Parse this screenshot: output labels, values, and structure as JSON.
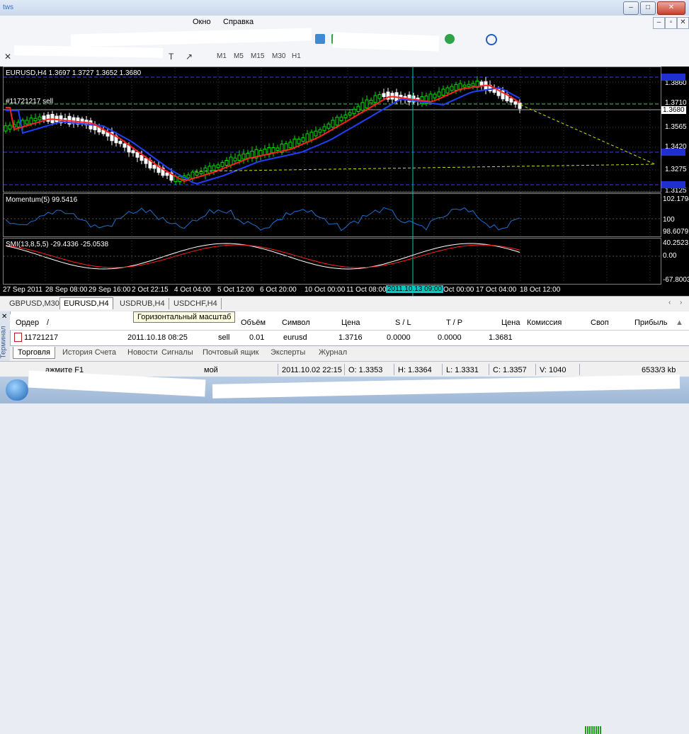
{
  "title_bar": {
    "left_text": "tws"
  },
  "window_controls": {
    "minimize": "–",
    "maximize": "□",
    "close": "✕"
  },
  "mdi_controls": {
    "minimize": "–",
    "restore": "▫",
    "close": "✕"
  },
  "menu": {
    "window": "Окно",
    "help": "Справка"
  },
  "timeframes": [
    "M1",
    "M5",
    "M15",
    "M30",
    "H1"
  ],
  "chart": {
    "info_label": "EURUSD,H4  1.3697 1.3727 1.3652 1.3680",
    "order_label": "#11721217 sell",
    "price_labels": [
      "1.3860",
      "1.3710",
      "1.3680",
      "1.3565",
      "1.3420",
      "1.3275",
      "1.3125"
    ],
    "momentum_label": "Momentum(5) 99.5416",
    "momentum_scale": [
      "102.1794",
      "100",
      "98.6079"
    ],
    "smi_label": "SMI(13,8,5,5) -29.4336 -25.0538",
    "smi_scale": [
      "40.2523",
      "0.00",
      "-67.8003"
    ],
    "time_labels": [
      "27 Sep 2011",
      "28 Sep 08:00",
      "29 Sep 16:00",
      "2 Oct 22:15",
      "4 Oct 04:00",
      "5 Oct 12:00",
      "6 Oct 20:00",
      "10 Oct 00:00",
      "11 Oct 08:00",
      "2011.10.13 09:00",
      "Oct 00:00",
      "17 Oct 04:00",
      "18 Oct 12:00"
    ],
    "colors": {
      "bull": "#00e000",
      "bear": "#ffffff",
      "ma_fast": "#ff2020",
      "ma_slow": "#2040ff",
      "momentum": "#1e6fd0",
      "level": "#3040ff",
      "cursor": "#00c8c8",
      "trend": "#c8e000"
    }
  },
  "chart_tabs": [
    "GBPUSD,M30",
    "EURUSD,H4",
    "USDRUB,H4",
    "USDCHF,H4"
  ],
  "tooltip": "Горизонтальный масштаб",
  "terminal": {
    "side_label": "Терминал",
    "columns": [
      "Ордер",
      "/",
      "Объём",
      "Символ",
      "Цена",
      "S / L",
      "T / P",
      "Цена",
      "Комиссия",
      "Своп",
      "Прибыль"
    ],
    "row": {
      "order": "11721217",
      "time": "2011.10.18 08:25",
      "type": "sell",
      "volume": "0.01",
      "symbol": "eurusd",
      "price": "1.3716",
      "sl": "0.0000",
      "tp": "0.0000",
      "cur_price": "1.3681"
    },
    "tabs": [
      "Торговля",
      "История Счета",
      "Новости",
      "Сигналы",
      "Почтовый ящик",
      "Эксперты",
      "Журнал"
    ]
  },
  "status": {
    "left": "ажмите F1",
    "profile": "мой",
    "datetime": "2011.10.02 22:15",
    "open": "O: 1.3353",
    "high": "H: 1.3364",
    "low": "L: 1.3331",
    "close": "C: 1.3357",
    "volume": "V: 1040",
    "traffic": "6533/3 kb"
  }
}
